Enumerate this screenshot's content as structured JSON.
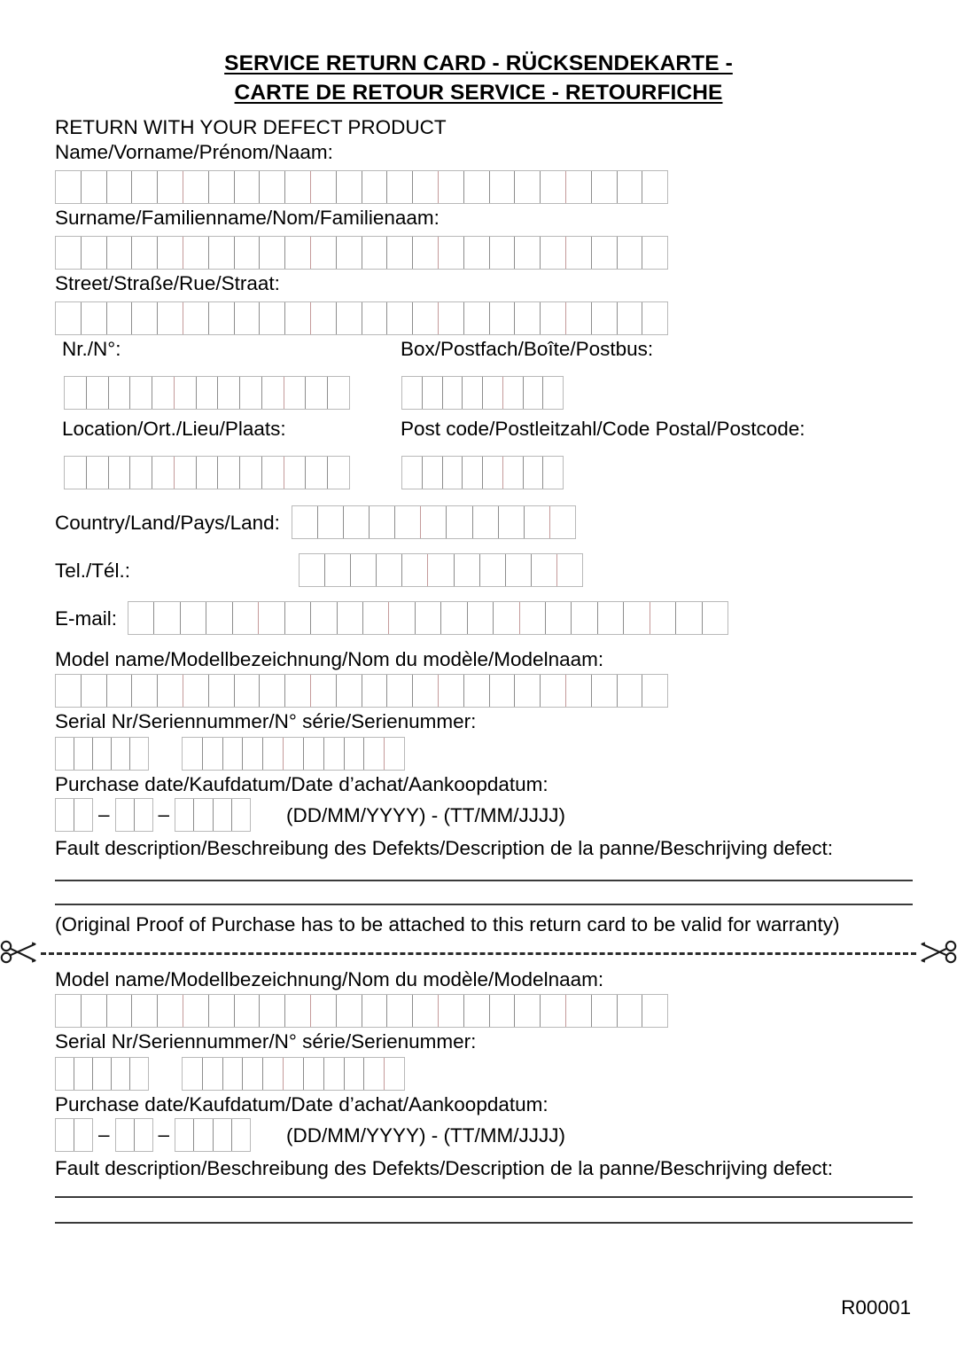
{
  "document": {
    "title_line_1": "SERVICE RETURN CARD - RÜCKSENDEKARTE -",
    "title_line_2": "CARTE DE RETOUR SERVICE - RETOURFICHE",
    "intro": "RETURN WITH YOUR DEFECT PRODUCT",
    "footer_code": "R00001"
  },
  "customer_section": {
    "name_label": "Name/Vorname/Prénom/Naam:",
    "surname_label": "Surname/Familienname/Nom/Familienaam:",
    "street_label": "Street/Straße/Rue/Straat:",
    "number_label": "Nr./N°:",
    "box_label": "Box/Postfach/Boîte/Postbus:",
    "location_label": "Location/Ort./Lieu/Plaats:",
    "postcode_label": "Post code/Postleitzahl/Code Postal/Postcode:",
    "country_label": "Country/Land/Pays/Land:",
    "tel_label": "Tel./Tél.:",
    "email_label": "E-mail:"
  },
  "product_section": {
    "model_label": "Model name/Modellbezeichnung/Nom du modèle/Modelnaam:",
    "serial_label": "Serial Nr/Seriennummer/N° série/Serienummer:",
    "purchase_date_label": "Purchase date/Kaufdatum/Date d’achat/Aankoopdatum:",
    "date_format_hint": "(DD/MM/YYYY) - (TT/MM/JJJJ)",
    "fault_label": "Fault description/Beschreibung des Defekts/Description de la panne/Beschrijving defect:"
  },
  "notice": {
    "proof_of_purchase": "(Original Proof of Purchase has to be attached to this return card to be valid for warranty)"
  },
  "stub_section": {
    "model_label": "Model name/Modellbezeichnung/Nom du modèle/Modelnaam:",
    "serial_label": "Serial Nr/Seriennummer/N° série/Serienummer:",
    "purchase_date_label": "Purchase date/Kaufdatum/Date d’achat/Aankoopdatum:",
    "date_format_hint": "(DD/MM/YYYY) - (TT/MM/JJJJ)",
    "fault_label": "Fault description/Beschreibung des Defekts/Description de la panne/Beschrijving defect:"
  },
  "field_cells": {
    "name": 24,
    "surname": 24,
    "street": 24,
    "number": 13,
    "box": 8,
    "location": 13,
    "postcode": 8,
    "country": 11,
    "tel": 11,
    "email": 23,
    "model": 24,
    "serial_prefix": 5,
    "serial_body": 11,
    "date_day": 2,
    "date_month": 2,
    "date_year": 4
  },
  "colors": {
    "ink": "#000000",
    "cell_border": "#8d8d8d",
    "box_border": "#b9b9b9",
    "rule": "#3a3a3a",
    "cut_dash": "#2b2b2b"
  },
  "icons": {
    "scissors_left": "scissors-icon",
    "scissors_right": "scissors-icon"
  }
}
